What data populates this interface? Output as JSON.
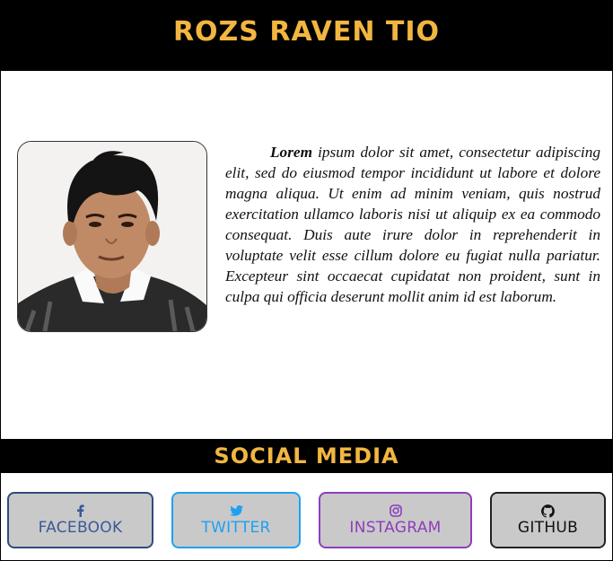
{
  "header": {
    "title": "ROZS RAVEN TIO"
  },
  "bio": {
    "lead": "Lorem",
    "text": " ipsum dolor sit amet, consectetur adipiscing elit, sed do eiusmod tempor incididunt ut labore et dolore magna aliqua. Ut enim ad minim veniam, quis nostrud exercitation ullamco laboris nisi ut aliquip ex ea commodo consequat. Duis aute irure dolor in reprehenderit in voluptate velit esse cillum dolore eu fugiat nulla pariatur. Excepteur sint occaecat cupidatat non proident, sunt in culpa qui officia deserunt mollit anim id est laborum."
  },
  "social": {
    "title": "SOCIAL MEDIA",
    "buttons": [
      {
        "label": "FACEBOOK",
        "icon": "facebook-icon",
        "color": "#3b5998"
      },
      {
        "label": "TWITTER",
        "icon": "twitter-icon",
        "color": "#1da1f2"
      },
      {
        "label": "INSTAGRAM",
        "icon": "instagram-icon",
        "color": "#8e3dbd"
      },
      {
        "label": "GITHUB",
        "icon": "github-icon",
        "color": "#111111"
      }
    ]
  },
  "colors": {
    "header_bg": "#000000",
    "accent": "#f2b640",
    "button_bg": "#c9c9c9"
  }
}
